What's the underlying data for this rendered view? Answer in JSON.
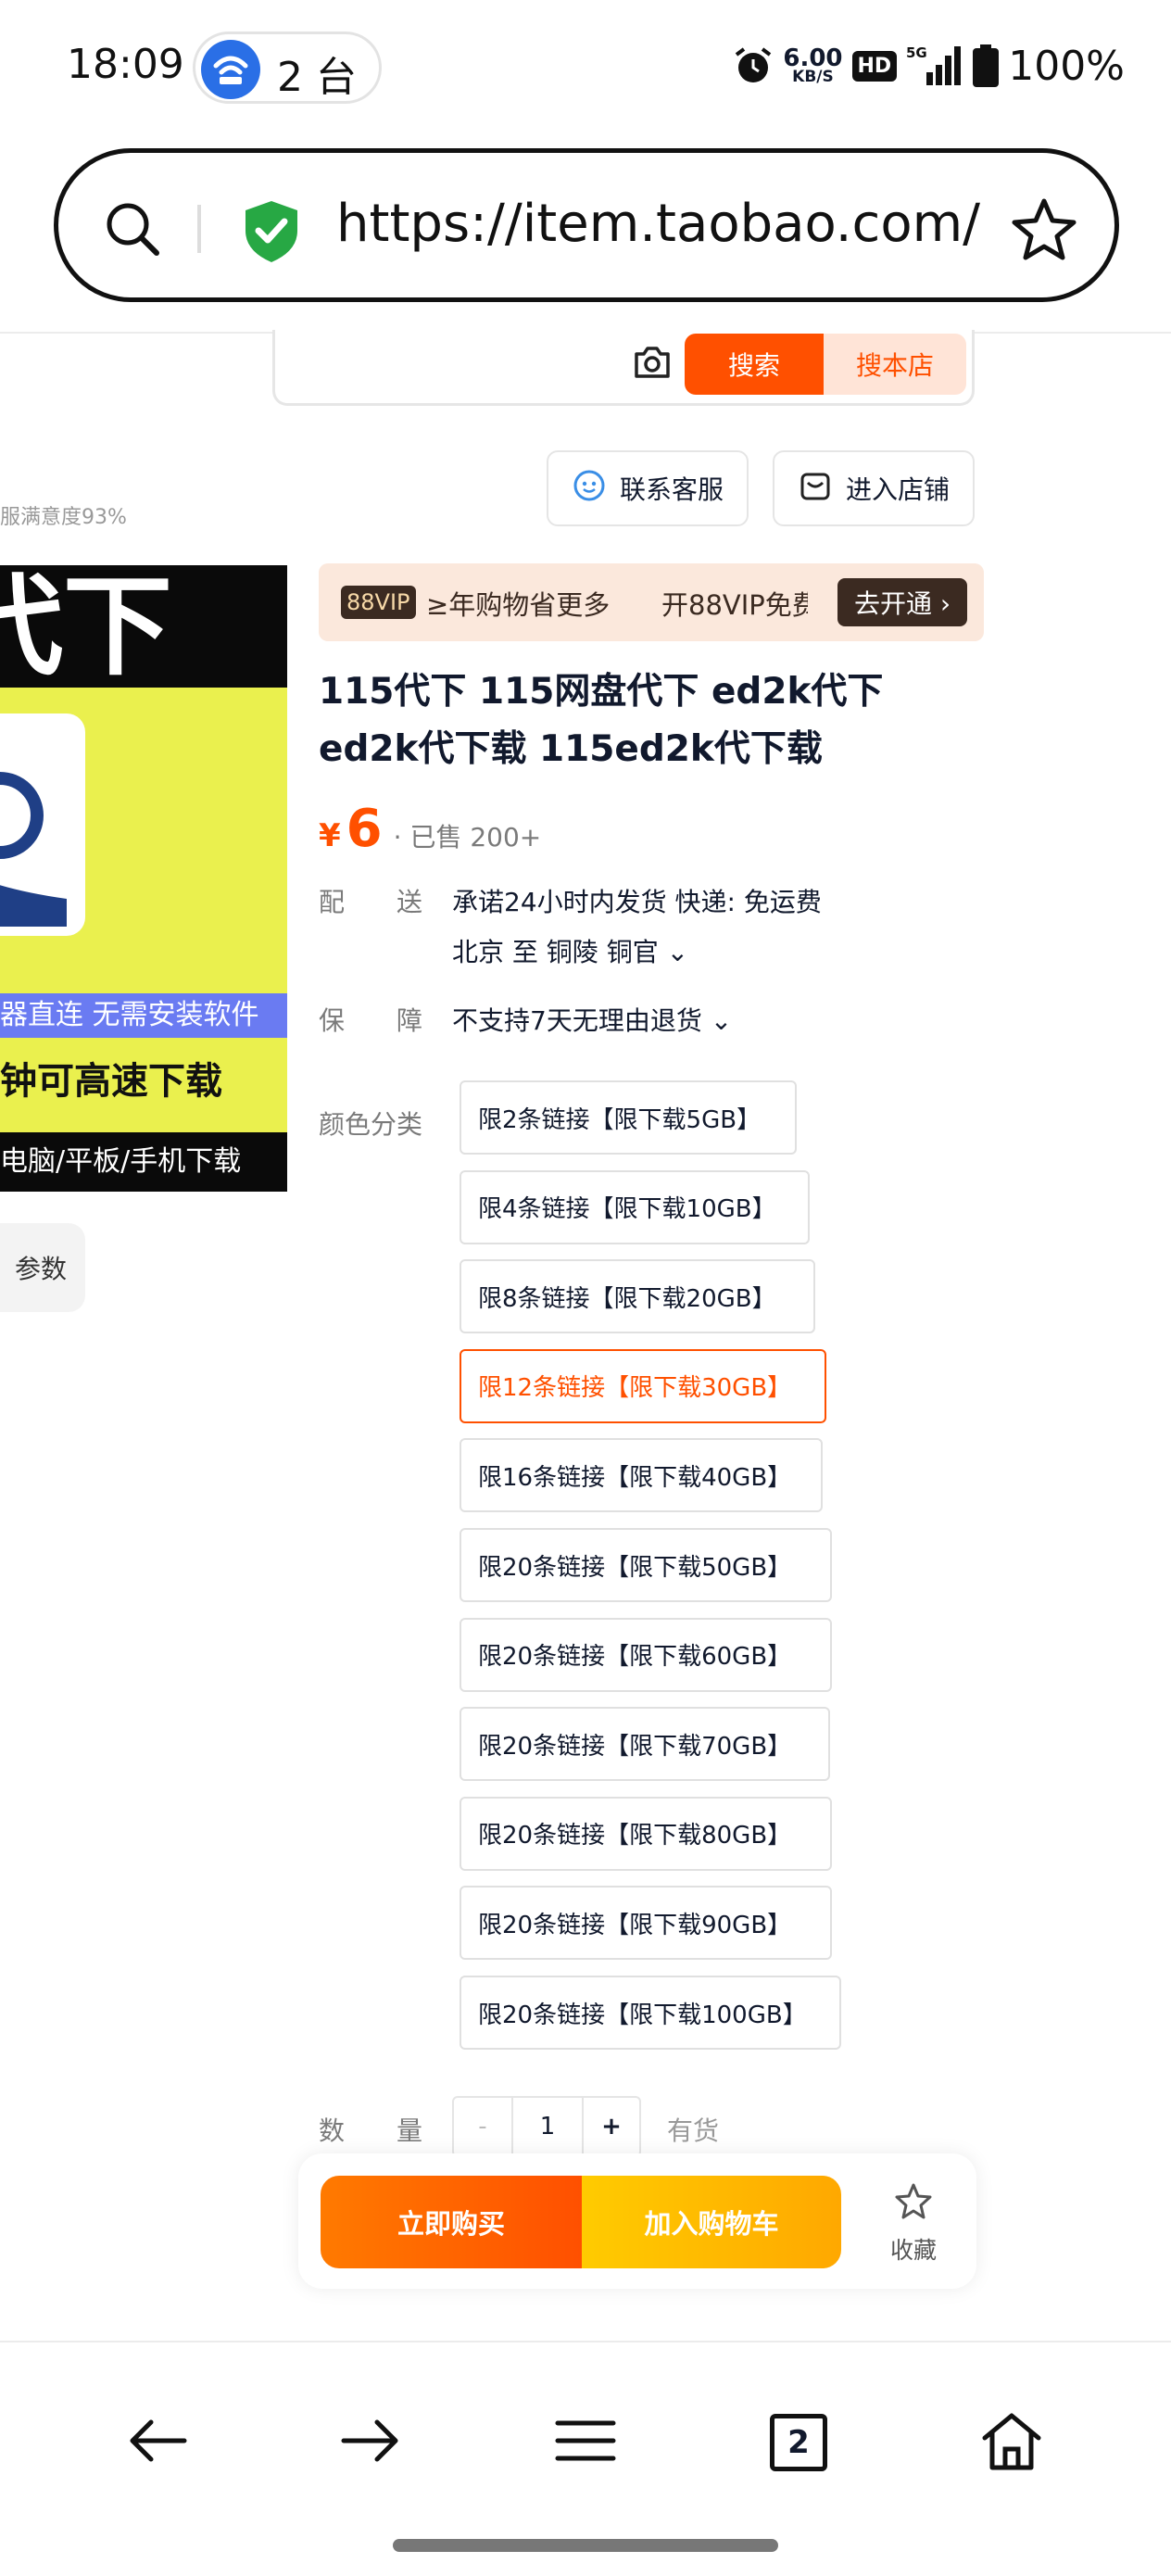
{
  "status_bar": {
    "time": "18:09",
    "hotspot_count": "2 台",
    "net_speed_value": "6.00",
    "net_speed_unit": "KB/S",
    "hd": "HD",
    "network": "5G",
    "battery": "100%"
  },
  "url_bar": {
    "url": "https://item.taobao.com/i..."
  },
  "page_search": {
    "search_label": "搜索",
    "store_search_label": "搜本店"
  },
  "shop": {
    "contact_service": "联系客服",
    "enter_store": "进入店铺",
    "satisfaction": "服满意度93%"
  },
  "product_image": {
    "top_text": "代下",
    "blue_bar_text": "器直连 无需安装软件",
    "big_text": "钟可高速下载",
    "bottom_text": "电脑/平板/手机下载",
    "params_label": "参数"
  },
  "vip_banner": {
    "tag": "88VIP",
    "text1": "≥年购物省更多",
    "text2": "开88VIP免费",
    "open_label": "去开通 ›"
  },
  "product": {
    "title": "115代下 115网盘代下 ed2k代下 ed2k代下载 115ed2k代下载",
    "price_currency": "¥",
    "price": "6",
    "sold": "· 已售 200+"
  },
  "delivery": {
    "label_1": "配",
    "label_2": "送",
    "promise": "承诺24小时内发货  快递: 免运费",
    "route": "北京  至  铜陵 铜官 ⌄"
  },
  "guarantee": {
    "label_1": "保",
    "label_2": "障",
    "value": "不支持7天无理由退货 ⌄"
  },
  "sku": {
    "label": "颜色分类",
    "selected_index": 3,
    "options": [
      "限2条链接【限下载5GB】",
      "限4条链接【限下载10GB】",
      "限8条链接【限下载20GB】",
      "限12条链接【限下载30GB】",
      "限16条链接【限下载40GB】",
      "限20条链接【限下载50GB】",
      "限20条链接【限下载60GB】",
      "限20条链接【限下载70GB】",
      "限20条链接【限下载80GB】",
      "限20条链接【限下载90GB】",
      "限20条链接【限下载100GB】"
    ]
  },
  "quantity": {
    "label_1": "数",
    "label_2": "量",
    "minus": "-",
    "value": "1",
    "plus": "+",
    "stock": "有货"
  },
  "actions": {
    "buy_now": "立即购买",
    "add_to_cart": "加入购物车",
    "favorite": "收藏"
  },
  "browser_nav": {
    "tab_count": "2"
  },
  "colors": {
    "accent": "#ff5000",
    "cart": "#ffb800",
    "vip_dark": "#3b2a21"
  }
}
